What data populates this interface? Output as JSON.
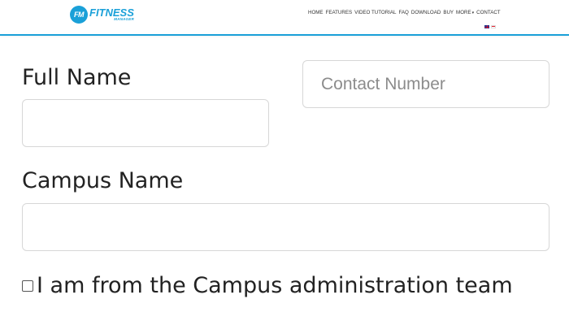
{
  "header": {
    "logo": {
      "badge": "FM",
      "name": "FITNESS",
      "sub": "MANAGER"
    },
    "nav": {
      "home": "HOME",
      "features": "FEATURES",
      "video_tutorial": "VIDEO TUTORIAL",
      "faq": "FAQ",
      "download": "DOWNLOAD",
      "buy": "BUY",
      "more": "MORE",
      "more_caret": "▾",
      "contact": "CONTACT"
    },
    "languages": [
      "en",
      "id"
    ]
  },
  "form": {
    "full_name": {
      "label": "Full Name",
      "value": "",
      "placeholder": ""
    },
    "contact_number": {
      "value": "",
      "placeholder": "Contact Number"
    },
    "campus_name": {
      "label": "Campus Name",
      "value": "",
      "placeholder": ""
    },
    "admin_checkbox": {
      "label": "I am from the Campus administration team",
      "checked": false
    }
  },
  "colors": {
    "brand": "#1aa0d8",
    "field_border": "#d7d7d7",
    "text": "#222222",
    "placeholder": "#8c8c8c"
  }
}
